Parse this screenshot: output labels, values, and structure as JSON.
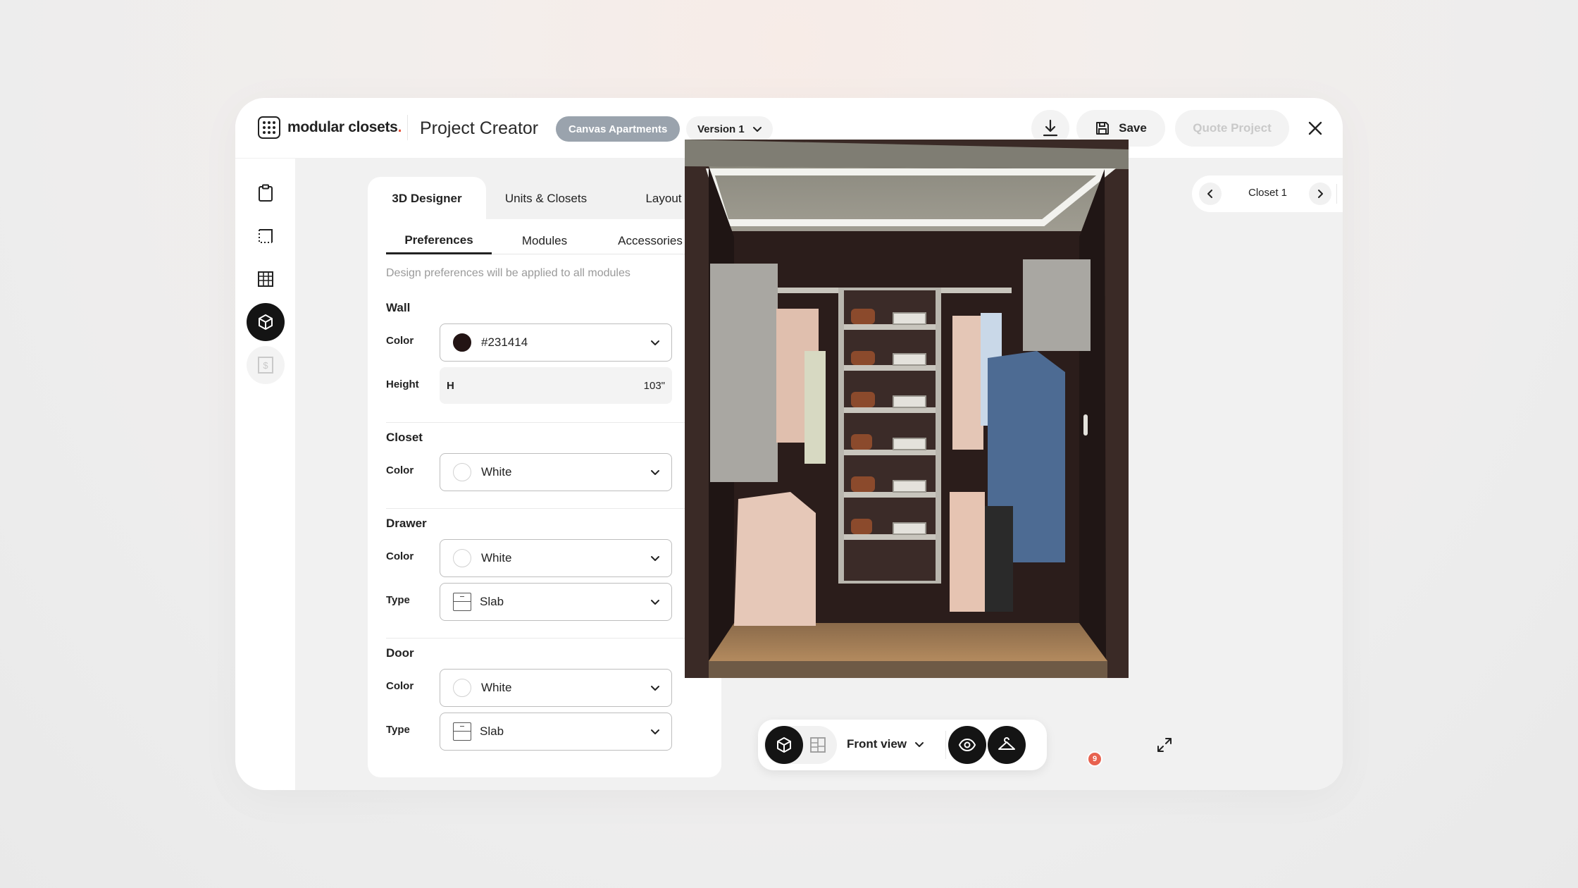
{
  "header": {
    "logo_text": "modular closets",
    "logo_dot": ".",
    "app_title": "Project Creator",
    "project_name": "Canvas Apartments",
    "version_label": "Version 1",
    "save_label": "Save",
    "quote_label": "Quote Project"
  },
  "sidebar": {
    "items": [
      {
        "icon": "clipboard-icon"
      },
      {
        "icon": "floorplan-icon"
      },
      {
        "icon": "table-icon"
      },
      {
        "icon": "cube-icon",
        "active": true
      },
      {
        "icon": "price-icon",
        "disabled": true
      }
    ]
  },
  "tabs": [
    "3D Designer",
    "Units & Closets",
    "Layout"
  ],
  "subtabs": [
    "Preferences",
    "Modules",
    "Accessories"
  ],
  "hint": "Design preferences will be applied to all modules",
  "sections": {
    "wall": {
      "title": "Wall",
      "color_label": "Color",
      "color_value": "#231414",
      "height_label": "Height",
      "height_prefix": "H",
      "height_value": "103\""
    },
    "closet": {
      "title": "Closet",
      "color_label": "Color",
      "color_value": "White"
    },
    "drawer": {
      "title": "Drawer",
      "color_label": "Color",
      "color_value": "White",
      "type_label": "Type",
      "type_value": "Slab"
    },
    "door": {
      "title": "Door",
      "color_label": "Color",
      "color_value": "White",
      "type_label": "Type",
      "type_value": "Slab"
    }
  },
  "viewer": {
    "closet_name": "Closet 1",
    "view_label": "Front view",
    "badge_count": "9"
  },
  "colors": {
    "accent_dark": "#141414",
    "pill_gray": "#9aa3ad",
    "logo_dot": "#e8553e",
    "badge": "#e8624f",
    "wall_color": "#231414"
  }
}
